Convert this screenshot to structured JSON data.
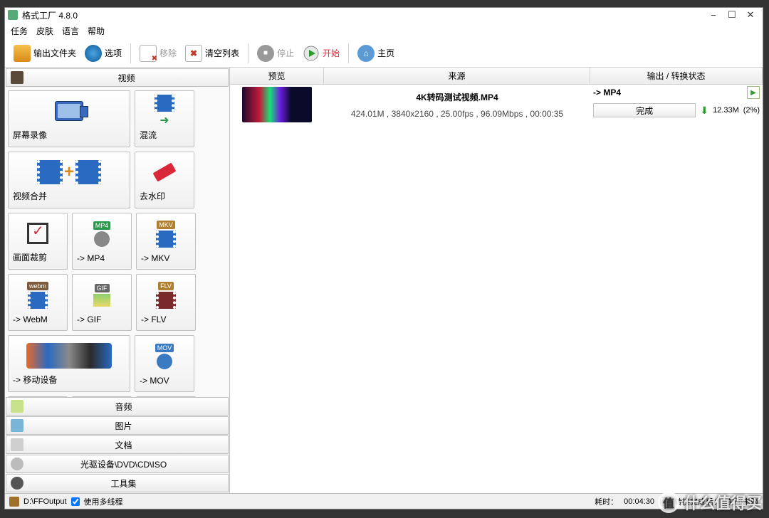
{
  "title": "格式工厂 4.8.0",
  "menu": {
    "task": "任务",
    "skin": "皮肤",
    "language": "语言",
    "help": "帮助"
  },
  "toolbar": {
    "output_folder": "输出文件夹",
    "options": "选项",
    "remove": "移除",
    "clear_list": "清空列表",
    "stop": "停止",
    "start": "开始",
    "home": "主页"
  },
  "sidebar": {
    "video_header": "视频",
    "tiles": [
      {
        "label": "屏幕录像",
        "size": "w2",
        "kind": "camera"
      },
      {
        "label": "混流",
        "size": "w1",
        "kind": "film-arrow"
      },
      {
        "label": "视频合并",
        "size": "w2",
        "kind": "join"
      },
      {
        "label": "去水印",
        "size": "w1",
        "kind": "eraser"
      },
      {
        "label": "画面裁剪",
        "size": "w1",
        "kind": "crop"
      },
      {
        "label": "-> MP4",
        "size": "w1",
        "kind": "mp4"
      },
      {
        "label": "-> MKV",
        "size": "w1",
        "kind": "mkv"
      },
      {
        "label": "-> WebM",
        "size": "w1",
        "kind": "webm"
      },
      {
        "label": "-> GIF",
        "size": "w1",
        "kind": "gif"
      },
      {
        "label": "-> FLV",
        "size": "w1",
        "kind": "flv"
      },
      {
        "label": "-> 移动设备",
        "size": "w2",
        "kind": "devices"
      },
      {
        "label": "-> MOV",
        "size": "w1",
        "kind": "mov"
      },
      {
        "label": "",
        "size": "w1",
        "kind": "ogg"
      },
      {
        "label": "",
        "size": "w1",
        "kind": "avi"
      },
      {
        "label": "",
        "size": "w1",
        "kind": "generic"
      }
    ],
    "categories": {
      "audio": "音频",
      "image": "图片",
      "document": "文档",
      "disc": "光驱设备\\DVD\\CD\\ISO",
      "tools": "工具集"
    }
  },
  "list": {
    "headers": {
      "preview": "预览",
      "source": "来源",
      "output": "输出 / 转换状态"
    },
    "row": {
      "filename": "4K转码测试视频.MP4",
      "info": "424.01M , 3840x2160 , 25.00fps , 96.09Mbps , 00:00:35",
      "out_format": "->  MP4",
      "status": "完成",
      "size": "12.33M",
      "pct": "(2%)"
    }
  },
  "statusbar": {
    "output_path": "D:\\FFOutput",
    "multithread": "使用多线程",
    "elapsed_label": "耗时：",
    "elapsed": "00:04:30",
    "after_label": "转换完成后：",
    "after_value": "关闭电脑"
  },
  "watermark": "什么值得买"
}
